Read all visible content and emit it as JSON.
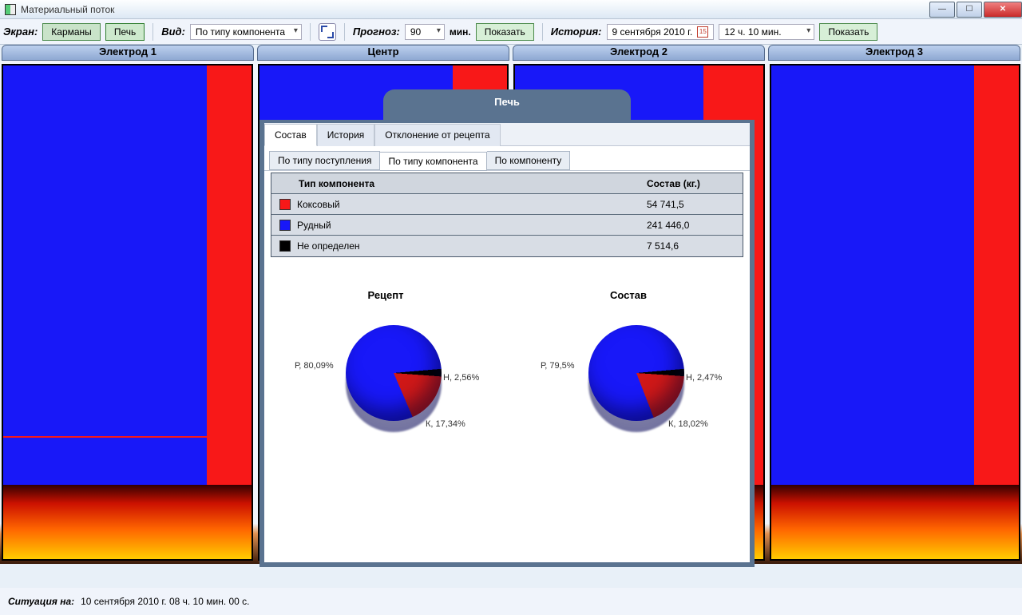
{
  "window": {
    "title": "Материальный поток"
  },
  "toolbar": {
    "screen_label": "Экран:",
    "btn_pockets": "Карманы",
    "btn_furnace": "Печь",
    "view_label": "Вид:",
    "view_value": "По типу компонента",
    "forecast_label": "Прогноз:",
    "forecast_value": "90",
    "forecast_unit": "мин.",
    "btn_show": "Показать",
    "history_label": "История:",
    "history_date": "9 сентября 2010 г.",
    "history_time": "12 ч. 10 мин.",
    "btn_show2": "Показать"
  },
  "columns": [
    "Электрод 1",
    "Центр",
    "Электрод 2",
    "Электрод 3"
  ],
  "modal": {
    "title": "Печь",
    "tabs": [
      "Состав",
      "История",
      "Отклонение от рецепта"
    ],
    "subtabs": [
      "По типу поступления",
      "По типу компонента",
      "По компоненту"
    ],
    "table": {
      "head_type": "Тип компонента",
      "head_val": "Состав (кг.)",
      "rows": [
        {
          "color": "#f81818",
          "name": "Коксовый",
          "value": "54 741,5"
        },
        {
          "color": "#1818f8",
          "name": "Рудный",
          "value": "241 446,0"
        },
        {
          "color": "#000000",
          "name": "Не определен",
          "value": "7 514,6"
        }
      ]
    },
    "chart_titles": {
      "left": "Рецепт",
      "right": "Состав"
    }
  },
  "chart_data": [
    {
      "type": "pie",
      "title": "Рецепт",
      "series": [
        {
          "name": "Р",
          "value": 80.09,
          "label": "Р, 80,09%",
          "color": "#1818f8"
        },
        {
          "name": "К",
          "value": 17.34,
          "label": "К, 17,34%",
          "color": "#d01818"
        },
        {
          "name": "Н",
          "value": 2.56,
          "label": "Н, 2,56%",
          "color": "#000000"
        }
      ]
    },
    {
      "type": "pie",
      "title": "Состав",
      "series": [
        {
          "name": "Р",
          "value": 79.5,
          "label": "Р, 79,5%",
          "color": "#1818f8"
        },
        {
          "name": "К",
          "value": 18.02,
          "label": "К, 18,02%",
          "color": "#d01818"
        },
        {
          "name": "Н",
          "value": 2.47,
          "label": "Н, 2,47%",
          "color": "#000000"
        }
      ]
    }
  ],
  "status": {
    "label": "Ситуация на:",
    "value": "10 сентября 2010 г.  08 ч. 10 мин. 00 с."
  }
}
